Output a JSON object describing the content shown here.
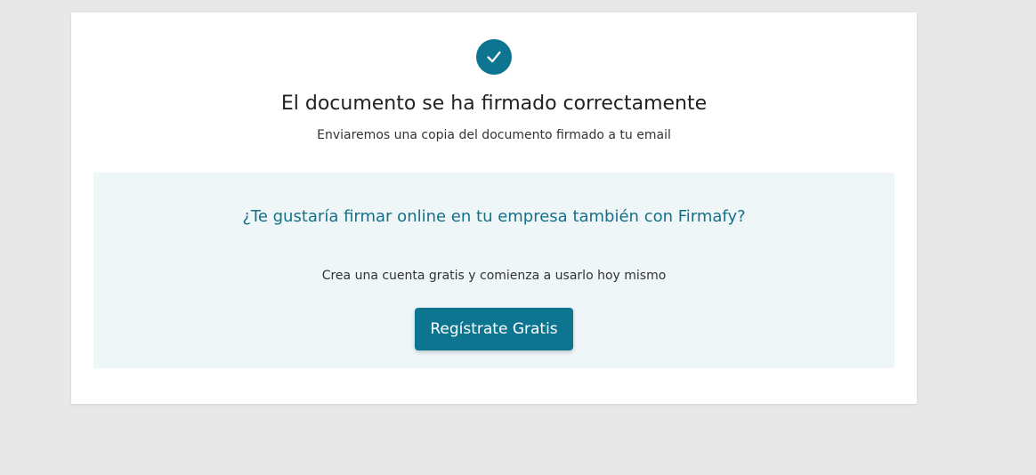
{
  "success": {
    "icon": "check-icon",
    "title": "El documento se ha firmado correctamente",
    "subtitle": "Enviaremos una copia del documento firmado a tu email"
  },
  "promo": {
    "title": "¿Te gustaría firmar online en tu empresa también con Firmafy?",
    "text": "Crea una cuenta gratis y comienza a usarlo hoy mismo",
    "button_label": "Regístrate Gratis"
  },
  "colors": {
    "page_background": "#e8e8e8",
    "card_background": "#ffffff",
    "accent": "#0e7590",
    "promo_background": "#eef6f8",
    "promo_title": "#166f87"
  }
}
